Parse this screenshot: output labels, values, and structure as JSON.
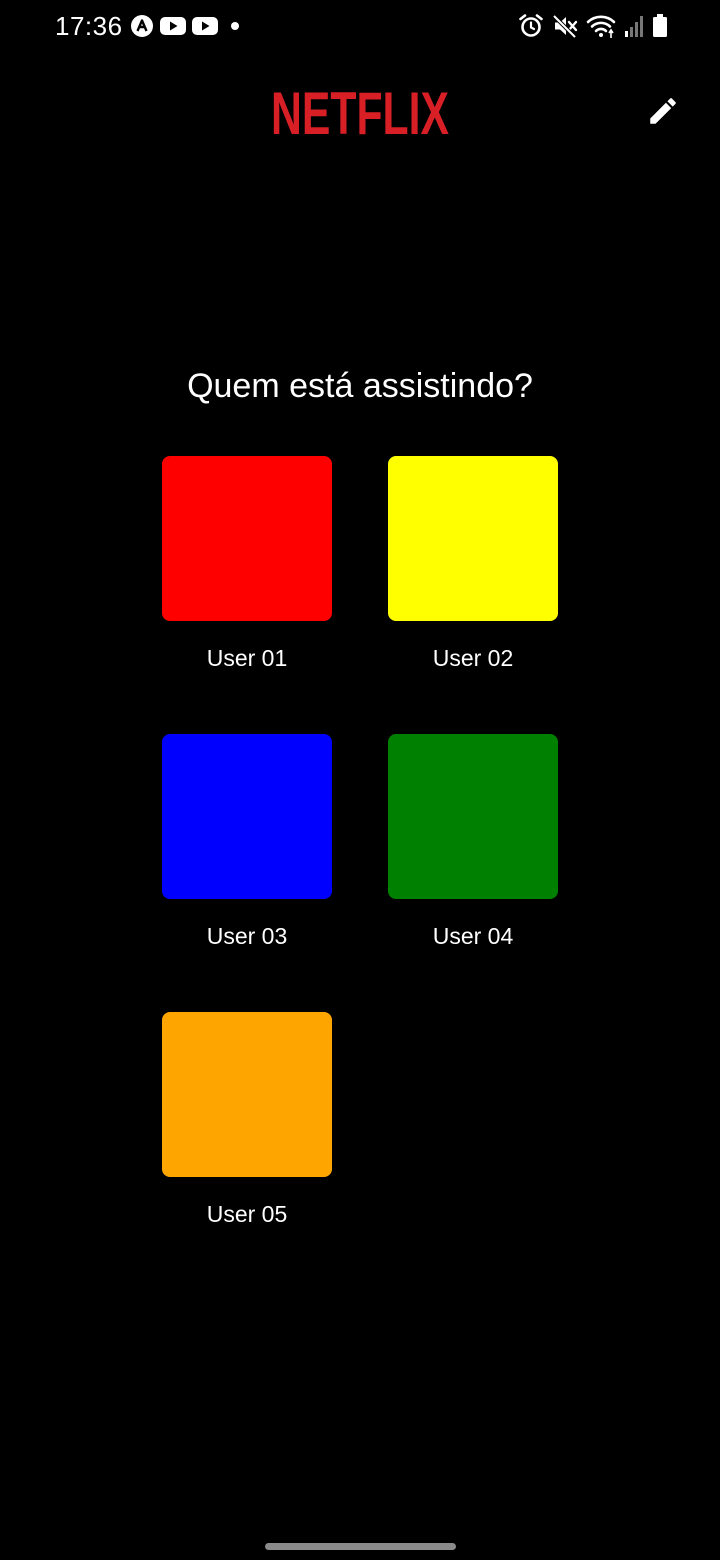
{
  "status_bar": {
    "time": "17:36",
    "left_icons": [
      "notification-a-icon",
      "youtube-icon",
      "youtube-icon",
      "dot-icon"
    ],
    "right_icons": [
      "alarm-icon",
      "mute-icon",
      "wifi-icon",
      "signal-icon",
      "battery-icon"
    ]
  },
  "header": {
    "logo_text": "NETFLIX",
    "logo_color": "#d81f26",
    "edit_icon": "pencil-icon"
  },
  "main": {
    "title": "Quem está assistindo?",
    "profiles": [
      {
        "name": "User 01",
        "color": "#ff0000"
      },
      {
        "name": "User 02",
        "color": "#ffff00"
      },
      {
        "name": "User 03",
        "color": "#0000ff"
      },
      {
        "name": "User 04",
        "color": "#008000"
      },
      {
        "name": "User 05",
        "color": "#ffa500"
      }
    ]
  },
  "colors": {
    "background": "#000000",
    "text": "#ffffff",
    "home_indicator": "#8a8a8a"
  }
}
